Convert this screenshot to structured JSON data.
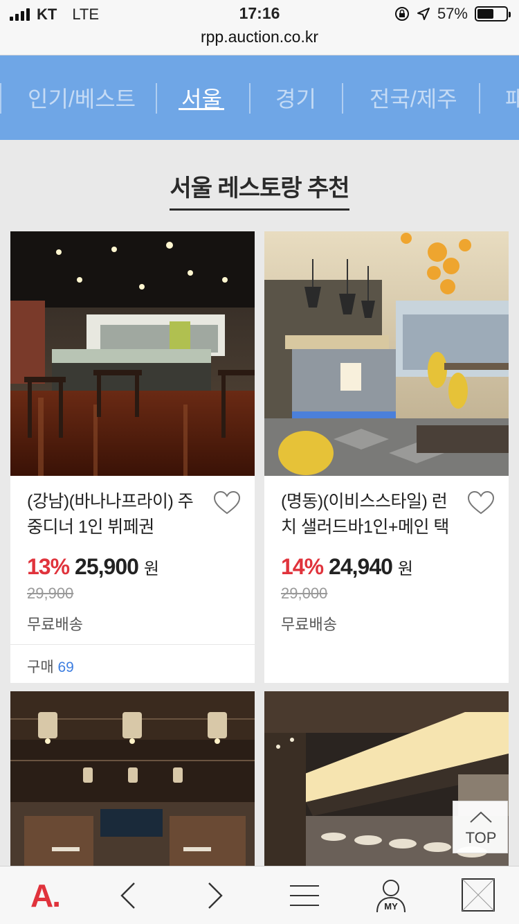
{
  "status_bar": {
    "carrier": "KT",
    "network": "LTE",
    "time": "17:16",
    "url": "rpp.auction.co.kr",
    "battery": "57%",
    "battery_level": 0.57
  },
  "category_nav": {
    "tabs": [
      {
        "label": "인기/베스트"
      },
      {
        "label": "서울"
      },
      {
        "label": "경기"
      },
      {
        "label": "전국/제주"
      },
      {
        "label": "패"
      }
    ],
    "active_tab": "서울"
  },
  "section": {
    "title": "서울 레스토랑 추천"
  },
  "products": [
    {
      "title": "(강남)(바나나프라이) 주중디너 1인 뷔페권",
      "discount": "13%",
      "price": "25,900",
      "currency": "원",
      "original_price": "29,900",
      "shipping": "무료배송",
      "purchase_label": "구매",
      "purchase_count": "69"
    },
    {
      "title": "(명동)(이비스스타일) 런치 샐러드바1인+메인 택",
      "discount": "14%",
      "price": "24,940",
      "currency": "원",
      "original_price": "29,000",
      "shipping": "무료배송"
    }
  ],
  "top_button": {
    "label": "TOP"
  },
  "bottom_bar": {
    "logo": "A.",
    "my_label": "MY",
    "icons": [
      "auction-logo-icon",
      "back-arrow-icon",
      "forward-arrow-icon",
      "menu-icon",
      "my-user-icon",
      "tabs-icon"
    ]
  },
  "colors": {
    "nav_blue": "#6fa6e6",
    "discount_red": "#e0333c",
    "count_blue": "#3d7ee0",
    "logo_red": "#e0333c"
  }
}
